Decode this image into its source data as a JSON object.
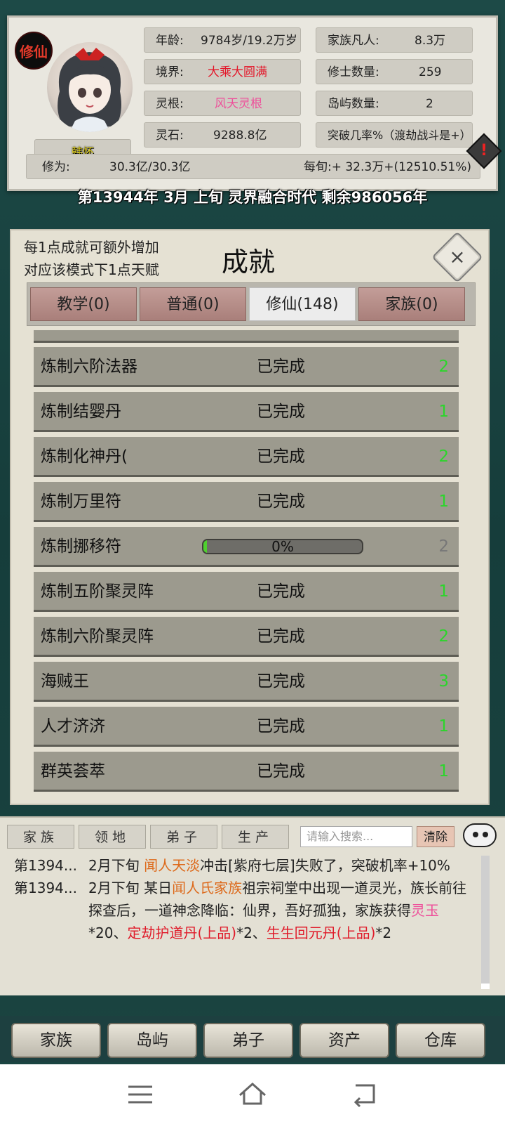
{
  "header": {
    "seal": "修仙",
    "character_name": "韩怀",
    "stats_left": [
      {
        "label": "年龄:",
        "value": "9784岁/19.2万岁"
      },
      {
        "label": "境界:",
        "value": "大乘大圆满"
      },
      {
        "label": "灵根:",
        "value": "风天灵根"
      },
      {
        "label": "灵石:",
        "value": "9288.8亿"
      }
    ],
    "stats_right": [
      {
        "label": "家族凡人:",
        "value": "8.3万"
      },
      {
        "label": "修士数量:",
        "value": "259"
      },
      {
        "label": "岛屿数量:",
        "value": "2"
      }
    ],
    "breakthrough": "突破几率%（渡劫战斗是+）",
    "alert_icon_text": "!",
    "cultivation_label": "修为:",
    "cultivation_value": "30.3亿/30.3亿",
    "per_turn": "每旬:+ 32.3万+(12510.51%)",
    "date_line": "第13944年 3月 上旬  灵界融合时代 剩余986056年"
  },
  "dialog": {
    "note_line1": "每1点成就可额外增加",
    "note_line2": "对应该模式下1点天赋",
    "title": "成就",
    "close_icon": "×",
    "tabs": [
      "教学(0)",
      "普通(0)",
      "修仙(148)",
      "家族(0)"
    ],
    "active_tab": 2,
    "rows": [
      {
        "name": "炼制六阶法器",
        "status": "已完成",
        "count": "2"
      },
      {
        "name": "炼制结婴丹",
        "status": "已完成",
        "count": "1"
      },
      {
        "name": "炼制化神丹(",
        "status": "已完成",
        "count": "2"
      },
      {
        "name": "炼制万里符",
        "status": "已完成",
        "count": "1"
      },
      {
        "name": "炼制挪移符",
        "progress_text": "0%",
        "progress": 0.0,
        "count": "2"
      },
      {
        "name": "炼制五阶聚灵阵",
        "status": "已完成",
        "count": "1"
      },
      {
        "name": "炼制六阶聚灵阵",
        "status": "已完成",
        "count": "2"
      },
      {
        "name": "海贼王",
        "status": "已完成",
        "count": "3"
      },
      {
        "name": "人才济济",
        "status": "已完成",
        "count": "1"
      },
      {
        "name": "群英荟萃",
        "status": "已完成",
        "count": "1"
      }
    ]
  },
  "log": {
    "tabs": [
      "家族",
      "领地",
      "弟子",
      "生产"
    ],
    "search_placeholder": "请输入搜索...",
    "clear_label": "清除",
    "entry1": {
      "date": "第1394...",
      "pre": "2月下旬 ",
      "name": "闻人天淡",
      "post": "冲击[紫府七层]失败了，突破机率+10%"
    },
    "entry2": {
      "date": "第1394...",
      "pre": "2月下旬 某日",
      "family": "闻人氏家族",
      "mid": "祖宗祠堂中出现一道灵光，族长前往探查后，一道神念降临：仙界，吾好孤独，家族获得",
      "item1": "灵玉",
      "q1": "*20、",
      "item2": "定劫护道丹(上品)",
      "q2": "*2、",
      "item3": "生生回元丹(上品)",
      "q3": "*2"
    }
  },
  "nav": [
    "家族",
    "岛屿",
    "弟子",
    "资产",
    "仓库"
  ]
}
